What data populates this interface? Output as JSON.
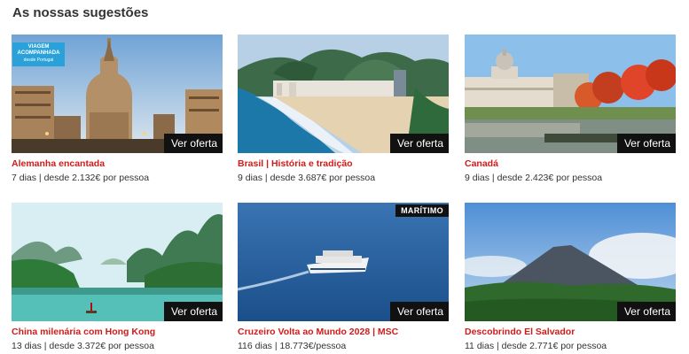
{
  "section": {
    "title": "As nossas sugestões"
  },
  "cta_label": "Ver oferta",
  "cards": [
    {
      "title": "Alemanha encantada",
      "info": "7 dias | desde 2.132€ por pessoa",
      "badge": {
        "line1": "VIAGEM",
        "line2": "ACOMPANHADA",
        "line3": "desde Portugal"
      }
    },
    {
      "title": "Brasil | História e tradição",
      "info": "9 dias | desde 3.687€ por pessoa"
    },
    {
      "title": "Canadá",
      "info": "9 dias | desde 2.423€ por pessoa"
    },
    {
      "title": "China milenária com Hong Kong",
      "info": "13 dias | desde 3.372€ por pessoa"
    },
    {
      "title": "Cruzeiro Volta ao Mundo 2028 | MSC",
      "info": "116 dias | 18.773€/pessoa",
      "tag": "MARÍTIMO"
    },
    {
      "title": "Descobrindo El Salvador",
      "info": "11 dias | desde 2.771€ por pessoa"
    }
  ],
  "colors": {
    "title_red": "#d11a1a",
    "badge_blue": "#2aa1d9",
    "button_black": "#111111"
  }
}
